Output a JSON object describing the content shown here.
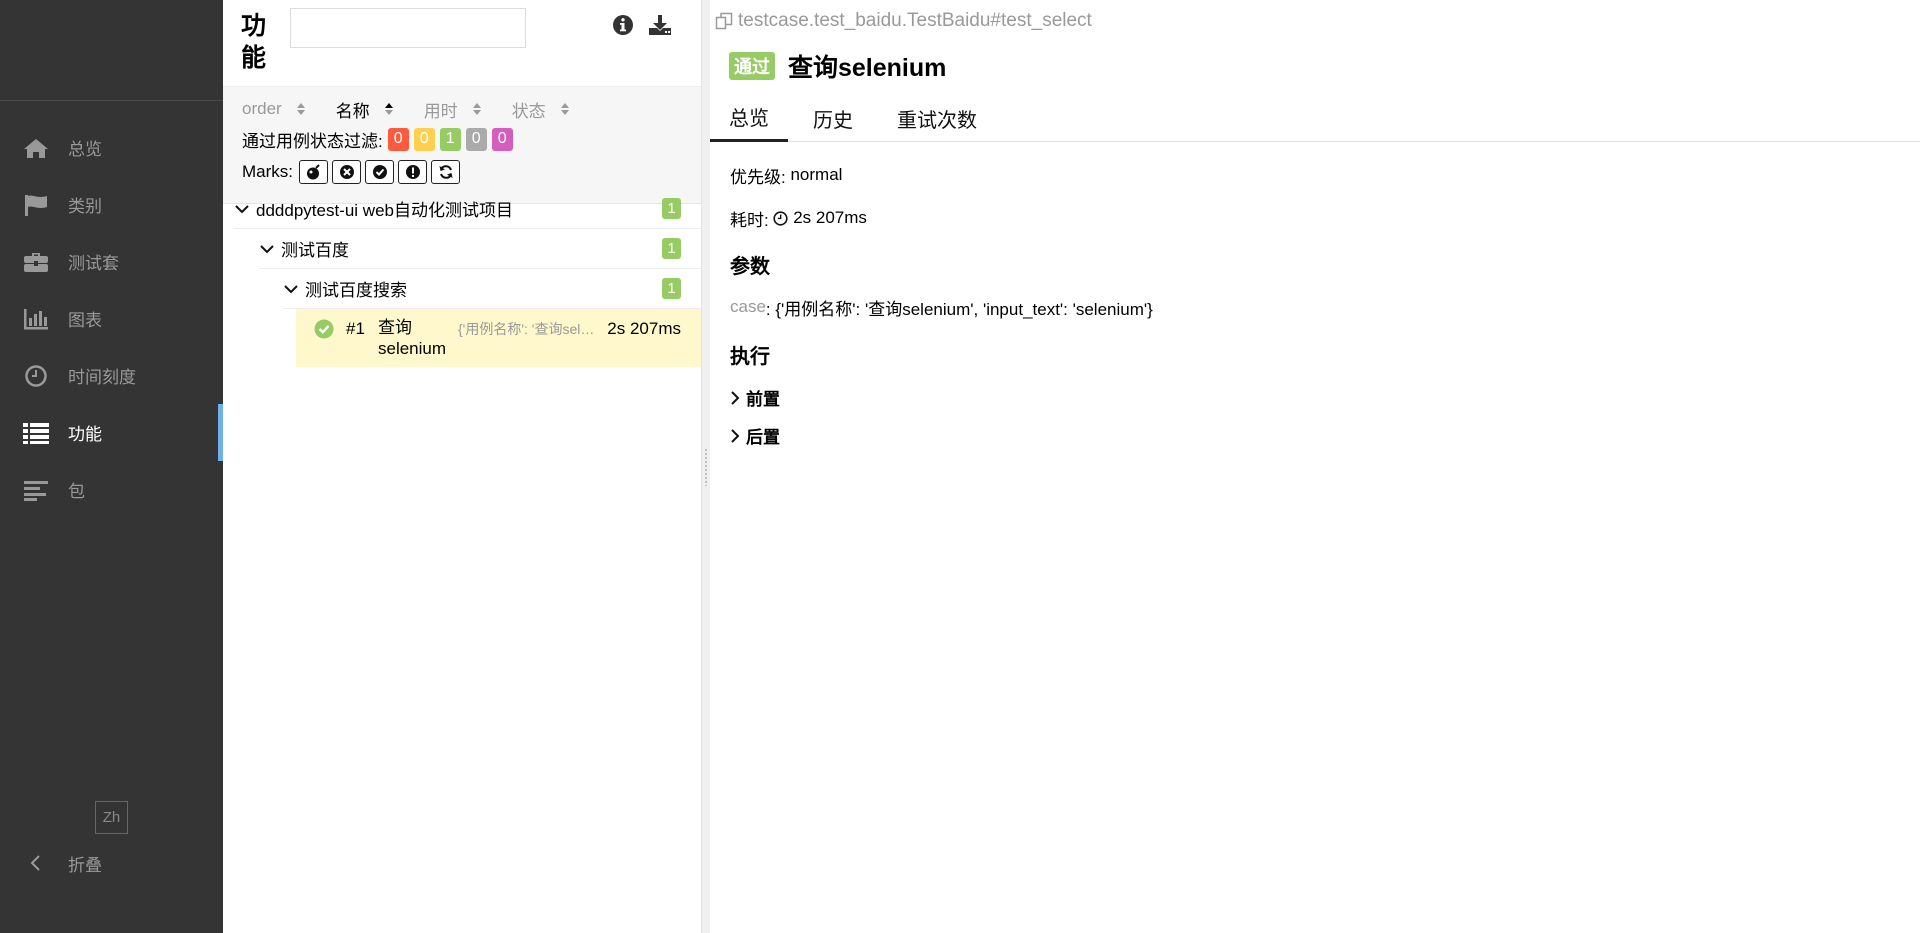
{
  "sidebar": {
    "items": [
      {
        "label": "总览",
        "icon": "home-icon"
      },
      {
        "label": "类别",
        "icon": "flag-icon"
      },
      {
        "label": "测试套",
        "icon": "briefcase-icon"
      },
      {
        "label": "图表",
        "icon": "bar-chart-icon"
      },
      {
        "label": "时间刻度",
        "icon": "clock-icon"
      },
      {
        "label": "功能",
        "icon": "list-icon",
        "active": true
      },
      {
        "label": "包",
        "icon": "align-left-icon"
      }
    ],
    "language": "Zh",
    "collapse_label": "折叠"
  },
  "tree_pane": {
    "title": "功能",
    "search": {
      "value": "",
      "placeholder": ""
    },
    "sort": [
      {
        "label": "order",
        "active": false
      },
      {
        "label": "名称",
        "active": true
      },
      {
        "label": "用时",
        "active": false
      },
      {
        "label": "状态",
        "active": false
      }
    ],
    "filter_label": "通过用例状态过滤:",
    "filter_badges": [
      {
        "value": "0",
        "color": "#fd5a3e"
      },
      {
        "value": "0",
        "color": "#ffd050"
      },
      {
        "value": "1",
        "color": "#97cc64"
      },
      {
        "value": "0",
        "color": "#aaaaaa"
      },
      {
        "value": "0",
        "color": "#d35ebe"
      }
    ],
    "marks_label": "Marks:",
    "marks": [
      "bomb-icon",
      "times-circle-icon",
      "check-circle-icon",
      "exclamation-circle-icon",
      "refresh-icon"
    ],
    "tree": [
      {
        "label": "ddddpytest-ui web自动化测试项目",
        "count": "1"
      },
      {
        "label": "测试百度",
        "count": "1"
      },
      {
        "label": "测试百度搜索",
        "count": "1"
      }
    ],
    "leaf": {
      "order": "#1",
      "name": "查询 selenium",
      "params": "{'用例名称': '查询selenium', 'input_text': 'selenium'}",
      "duration": "2s 207ms"
    }
  },
  "detail": {
    "breadcrumb": "testcase.test_baidu.TestBaidu#test_select",
    "status": "通过",
    "title": "查询selenium",
    "tabs": [
      "总览",
      "历史",
      "重试次数"
    ],
    "severity_label": "优先级:",
    "severity_value": "normal",
    "duration_label": "耗时:",
    "duration_value": "2s 207ms",
    "params_title": "参数",
    "param_key": "case",
    "param_value": ": {'用例名称': '查询selenium', 'input_text': 'selenium'}",
    "execution_title": "执行",
    "setup_label": "前置",
    "teardown_label": "后置"
  },
  "colors": {
    "sidebar_bg": "#343434",
    "accent": "#6eb1e8",
    "passed": "#97cc64",
    "selected_row": "#fff8cc"
  }
}
